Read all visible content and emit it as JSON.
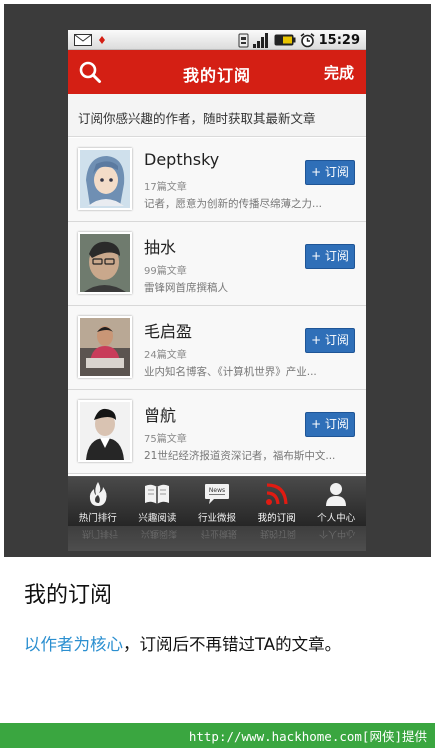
{
  "status_bar": {
    "time": "15:29",
    "icons": [
      "mail-icon",
      "notification-dot-icon",
      "sim-icon",
      "signal-icon",
      "battery-icon",
      "alarm-icon"
    ]
  },
  "title_bar": {
    "title": "我的订阅",
    "done_label": "完成",
    "search_icon": "search-icon",
    "background": "#d41f14"
  },
  "subtitle": "订阅你感兴趣的作者，随时获取其最新文章",
  "authors": [
    {
      "name": "Depthsky",
      "count": "17篇文章",
      "desc": "记者，愿意为创新的传播尽绵薄之力...",
      "button": "+ 订阅"
    },
    {
      "name": "抽水",
      "count": "99篇文章",
      "desc": "雷锋网首席撰稿人",
      "button": "+ 订阅"
    },
    {
      "name": "毛启盈",
      "count": "24篇文章",
      "desc": "业内知名博客、《计算机世界》产业...",
      "button": "+ 订阅"
    },
    {
      "name": "曾航",
      "count": "75篇文章",
      "desc": "21世纪经济报道资深记者，福布斯中文...",
      "button": "+ 订阅"
    }
  ],
  "tabs": [
    {
      "label": "热门排行",
      "icon": "fire-icon"
    },
    {
      "label": "兴趣阅读",
      "icon": "book-icon"
    },
    {
      "label": "行业微报",
      "icon": "news-bubble-icon",
      "icon_text": "News"
    },
    {
      "label": "我的订阅",
      "icon": "rss-icon",
      "active": true
    },
    {
      "label": "个人中心",
      "icon": "person-icon"
    }
  ],
  "caption": {
    "title": "我的订阅",
    "highlight": "以作者为核心",
    "rest": "，订阅后不再错过TA的文章。"
  },
  "footer": "http://www.hackhome.com[网侠]提供",
  "colors": {
    "accent_red": "#d41f14",
    "button_blue": "#2f6fb8",
    "highlight_blue": "#2b8fd0",
    "footer_green": "#3aa640"
  }
}
